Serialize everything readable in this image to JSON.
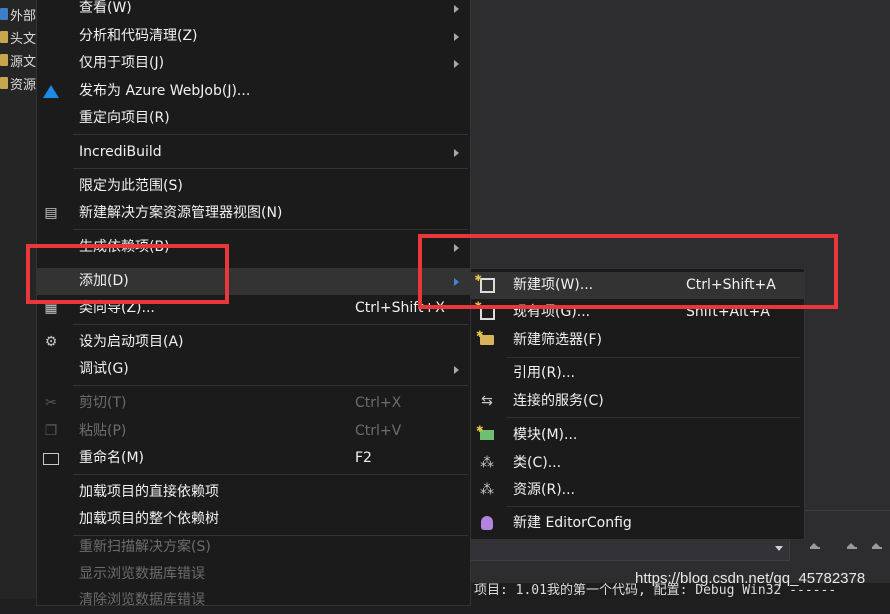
{
  "solution_explorer": {
    "items": [
      "外部",
      "头文",
      "源文",
      "资源"
    ]
  },
  "main_menu": {
    "items": [
      {
        "label": "查看(W)",
        "shortcut": "",
        "icon": "",
        "submenu": true,
        "disabled": false
      },
      {
        "label": "分析和代码清理(Z)",
        "shortcut": "",
        "icon": "",
        "submenu": true,
        "disabled": false
      },
      {
        "label": "仅用于项目(J)",
        "shortcut": "",
        "icon": "",
        "submenu": true,
        "disabled": false
      },
      {
        "label": "发布为 Azure WebJob(J)...",
        "shortcut": "",
        "icon": "azure-icon",
        "submenu": false,
        "disabled": false
      },
      {
        "label": "重定向项目(R)",
        "shortcut": "",
        "icon": "",
        "submenu": false,
        "disabled": false
      },
      {
        "label": "IncrediBuild",
        "shortcut": "",
        "icon": "",
        "submenu": true,
        "disabled": false
      },
      {
        "label": "限定为此范围(S)",
        "shortcut": "",
        "icon": "",
        "submenu": false,
        "disabled": false
      },
      {
        "label": "新建解决方案资源管理器视图(N)",
        "shortcut": "",
        "icon": "solution-view-icon",
        "submenu": false,
        "disabled": false
      },
      {
        "label": "生成依赖项(B)",
        "shortcut": "",
        "icon": "",
        "submenu": true,
        "disabled": false
      },
      {
        "label": "添加(D)",
        "shortcut": "",
        "icon": "",
        "submenu": true,
        "disabled": false
      },
      {
        "label": "类向导(Z)...",
        "shortcut": "Ctrl+Shift+X",
        "icon": "class-wizard-icon",
        "submenu": false,
        "disabled": false
      },
      {
        "label": "设为启动项目(A)",
        "shortcut": "",
        "icon": "gear-icon",
        "submenu": false,
        "disabled": false
      },
      {
        "label": "调试(G)",
        "shortcut": "",
        "icon": "",
        "submenu": true,
        "disabled": false
      },
      {
        "label": "剪切(T)",
        "shortcut": "Ctrl+X",
        "icon": "scissors-icon",
        "submenu": false,
        "disabled": true
      },
      {
        "label": "粘贴(P)",
        "shortcut": "Ctrl+V",
        "icon": "paste-icon",
        "submenu": false,
        "disabled": true
      },
      {
        "label": "重命名(M)",
        "shortcut": "F2",
        "icon": "rename-icon",
        "submenu": false,
        "disabled": false
      },
      {
        "label": "加载项目的直接依赖项",
        "shortcut": "",
        "icon": "",
        "submenu": false,
        "disabled": false
      },
      {
        "label": "加载项目的整个依赖树",
        "shortcut": "",
        "icon": "",
        "submenu": false,
        "disabled": false
      },
      {
        "label": "重新扫描解决方案(S)",
        "shortcut": "",
        "icon": "",
        "submenu": false,
        "disabled": true
      },
      {
        "label": "显示浏览数据库错误",
        "shortcut": "",
        "icon": "",
        "submenu": false,
        "disabled": true
      },
      {
        "label": "清除浏览数据库错误",
        "shortcut": "",
        "icon": "",
        "submenu": false,
        "disabled": true
      }
    ]
  },
  "add_submenu": {
    "items": [
      {
        "label": "新建项(W)...",
        "shortcut": "Ctrl+Shift+A",
        "icon": "new-item-icon"
      },
      {
        "label": "现有项(G)...",
        "shortcut": "Shift+Alt+A",
        "icon": "existing-item-icon"
      },
      {
        "label": "新建筛选器(F)",
        "shortcut": "",
        "icon": "new-filter-icon"
      },
      {
        "label": "引用(R)...",
        "shortcut": "",
        "icon": ""
      },
      {
        "label": "连接的服务(C)",
        "shortcut": "",
        "icon": "connected-service-icon"
      },
      {
        "label": "模块(M)...",
        "shortcut": "",
        "icon": "module-icon"
      },
      {
        "label": "类(C)...",
        "shortcut": "",
        "icon": "class-icon"
      },
      {
        "label": "资源(R)...",
        "shortcut": "",
        "icon": "resource-icon"
      },
      {
        "label": "新建 EditorConfig",
        "shortcut": "",
        "icon": "editorconfig-icon"
      }
    ]
  },
  "output": {
    "text": "项目: 1.01我的第一个代码, 配置: Debug Win32 ------"
  },
  "watermark": "https://blog.csdn.net/qq_45782378",
  "colors": {
    "highlight": "#e8383b",
    "azure": "#1e88e5",
    "menu_bg": "#1b1b1c"
  }
}
